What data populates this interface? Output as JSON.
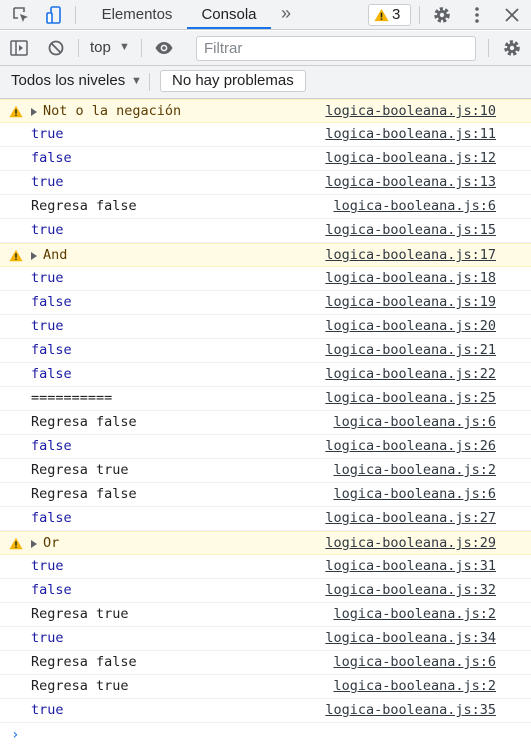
{
  "tabs": [
    {
      "label": "Elementos"
    },
    {
      "label": "Consola"
    }
  ],
  "warnings_count": "3",
  "toolbar": {
    "context": "top",
    "filter_placeholder": "Filtrar",
    "levels": "Todos los niveles",
    "issues": "No hay problemas"
  },
  "rows": [
    {
      "kind": "warning",
      "message": "Not o la negación",
      "source": "logica-booleana.js:10"
    },
    {
      "kind": "bool",
      "message": "true",
      "source": "logica-booleana.js:11"
    },
    {
      "kind": "bool",
      "message": "false",
      "source": "logica-booleana.js:12"
    },
    {
      "kind": "bool",
      "message": "true",
      "source": "logica-booleana.js:13"
    },
    {
      "kind": "log",
      "message": "Regresa false",
      "source": "logica-booleana.js:6"
    },
    {
      "kind": "bool",
      "message": "true",
      "source": "logica-booleana.js:15"
    },
    {
      "kind": "warning",
      "message": "And",
      "source": "logica-booleana.js:17"
    },
    {
      "kind": "bool",
      "message": "true",
      "source": "logica-booleana.js:18"
    },
    {
      "kind": "bool",
      "message": "false",
      "source": "logica-booleana.js:19"
    },
    {
      "kind": "bool",
      "message": "true",
      "source": "logica-booleana.js:20"
    },
    {
      "kind": "bool",
      "message": "false",
      "source": "logica-booleana.js:21"
    },
    {
      "kind": "bool",
      "message": "false",
      "source": "logica-booleana.js:22"
    },
    {
      "kind": "log",
      "message": "==========",
      "source": "logica-booleana.js:25"
    },
    {
      "kind": "log",
      "message": "Regresa false",
      "source": "logica-booleana.js:6"
    },
    {
      "kind": "bool",
      "message": "false",
      "source": "logica-booleana.js:26"
    },
    {
      "kind": "log",
      "message": "Regresa true",
      "source": "logica-booleana.js:2"
    },
    {
      "kind": "log",
      "message": "Regresa false",
      "source": "logica-booleana.js:6"
    },
    {
      "kind": "bool",
      "message": "false",
      "source": "logica-booleana.js:27"
    },
    {
      "kind": "warning",
      "message": "Or",
      "source": "logica-booleana.js:29"
    },
    {
      "kind": "bool",
      "message": "true",
      "source": "logica-booleana.js:31"
    },
    {
      "kind": "bool",
      "message": "false",
      "source": "logica-booleana.js:32"
    },
    {
      "kind": "log",
      "message": "Regresa true",
      "source": "logica-booleana.js:2"
    },
    {
      "kind": "bool",
      "message": "true",
      "source": "logica-booleana.js:34"
    },
    {
      "kind": "log",
      "message": "Regresa false",
      "source": "logica-booleana.js:6"
    },
    {
      "kind": "log",
      "message": "Regresa true",
      "source": "logica-booleana.js:2"
    },
    {
      "kind": "bool",
      "message": "true",
      "source": "logica-booleana.js:35"
    }
  ],
  "prompt": "›"
}
